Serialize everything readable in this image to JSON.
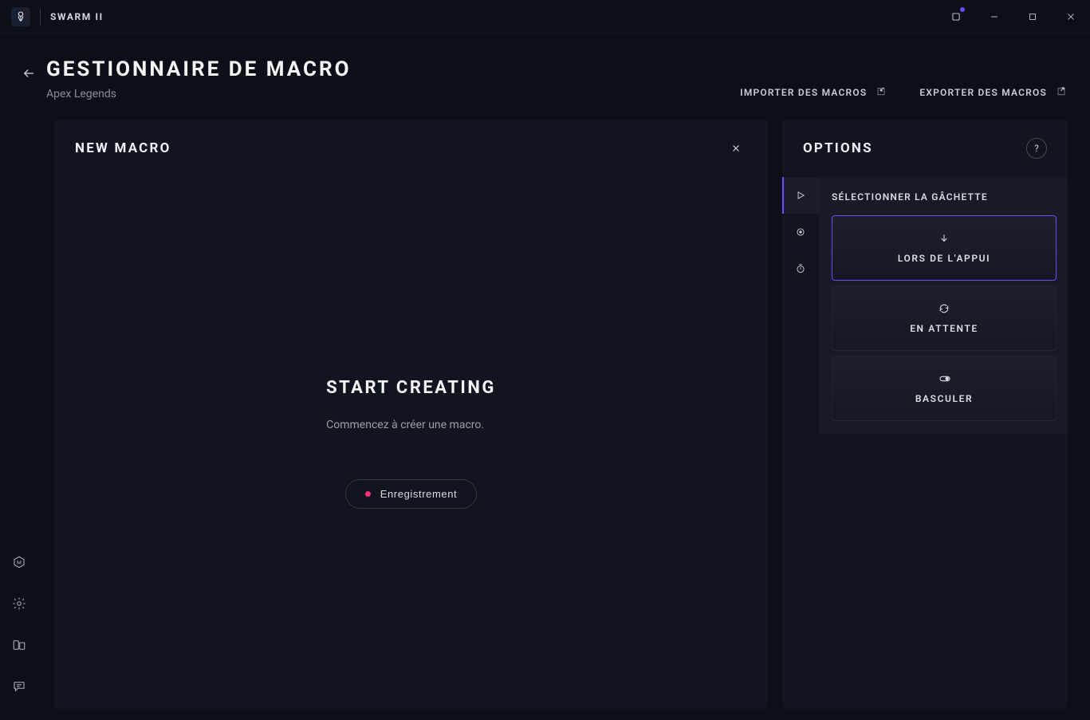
{
  "titlebar": {
    "product_name": "SWARM II"
  },
  "page": {
    "title": "GESTIONNAIRE DE MACRO",
    "subtitle": "Apex Legends"
  },
  "header_actions": {
    "import_label": "IMPORTER DES MACROS",
    "export_label": "EXPORTER DES MACROS"
  },
  "main_panel": {
    "title": "NEW MACRO",
    "empty_title": "START CREATING",
    "empty_sub": "Commencez à créer une macro.",
    "record_label": "Enregistrement"
  },
  "options_panel": {
    "title": "OPTIONS",
    "help_label": "?",
    "section_title": "SÉLECTIONNER LA GÂCHETTE",
    "triggers": [
      {
        "label": "LORS DE L'APPUI",
        "selected": true,
        "icon": "arrow-down"
      },
      {
        "label": "EN ATTENTE",
        "selected": false,
        "icon": "refresh"
      },
      {
        "label": "BASCULER",
        "selected": false,
        "icon": "toggle"
      }
    ]
  }
}
